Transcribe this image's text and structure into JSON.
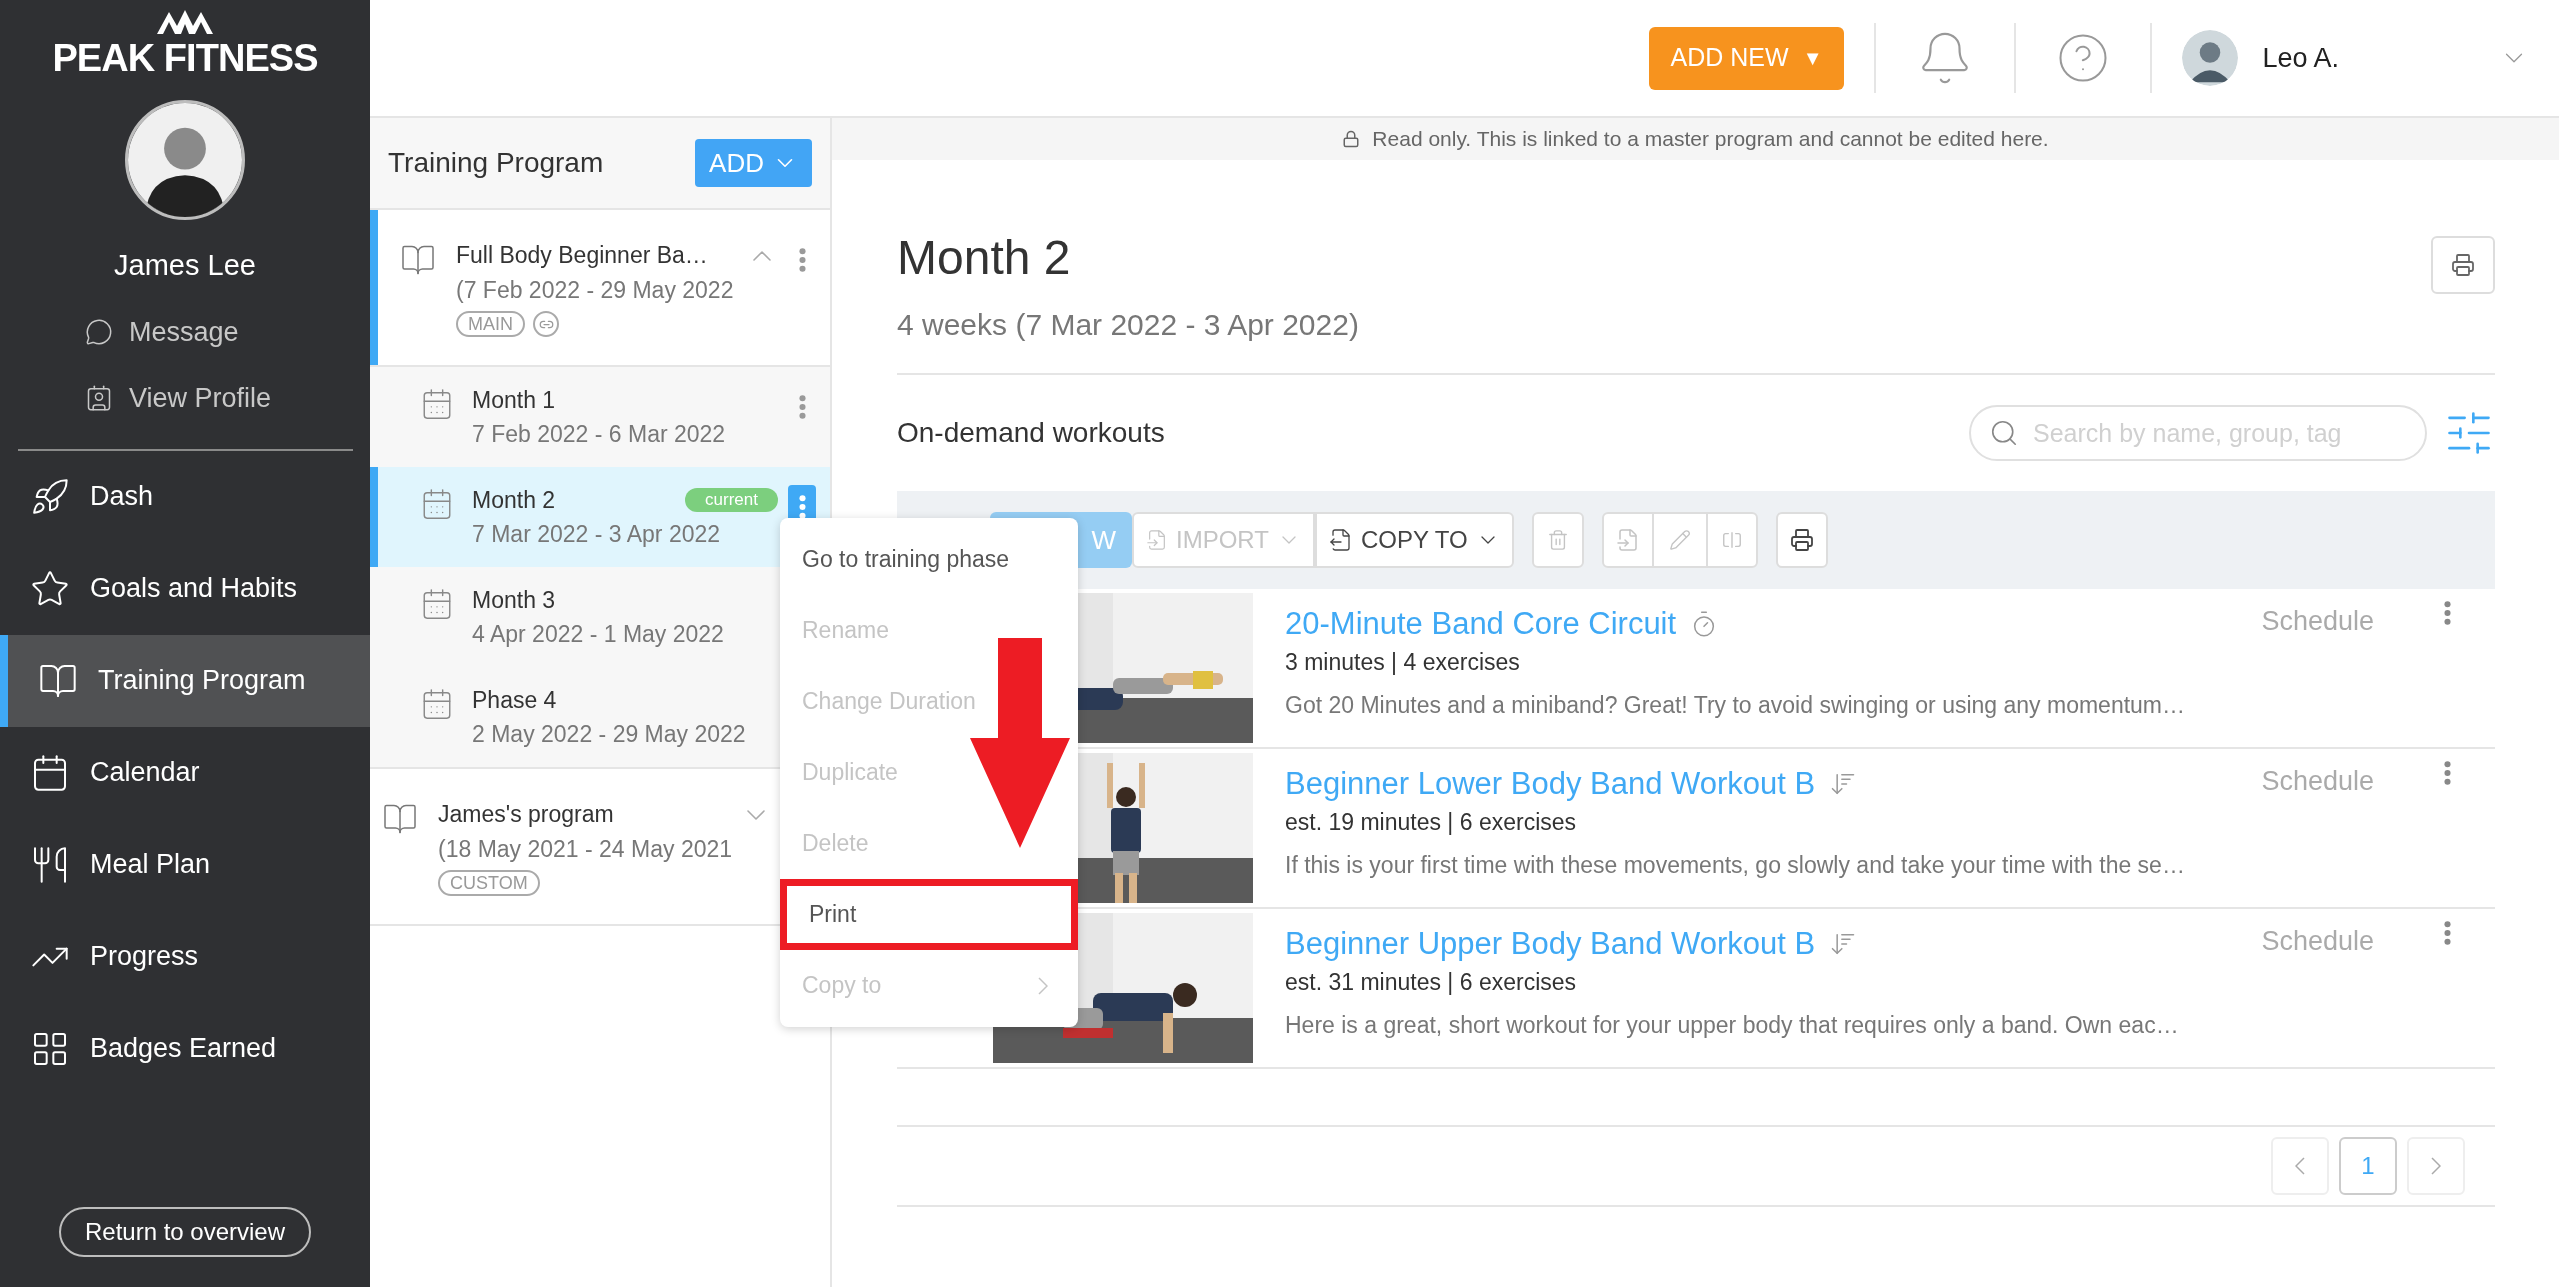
{
  "brand": {
    "name": "PEAK FITNESS"
  },
  "client": {
    "name": "James Lee",
    "links": [
      {
        "label": "Message"
      },
      {
        "label": "View Profile"
      }
    ]
  },
  "nav": [
    {
      "label": "Dash",
      "selected": false
    },
    {
      "label": "Goals and Habits",
      "selected": false
    },
    {
      "label": "Training Program",
      "selected": true
    },
    {
      "label": "Calendar",
      "selected": false
    },
    {
      "label": "Meal Plan",
      "selected": false
    },
    {
      "label": "Progress",
      "selected": false
    },
    {
      "label": "Badges Earned",
      "selected": false
    }
  ],
  "return_button": "Return to overview",
  "header": {
    "add_new": {
      "label": "ADD NEW",
      "caret": "▼"
    },
    "user": {
      "name": "Leo A."
    }
  },
  "banner": "Read only. This is linked to a master program and cannot be edited here.",
  "program_panel": {
    "title": "Training Program",
    "add_button": "ADD",
    "programs": [
      {
        "name": "Full Body Beginner Ba…",
        "dates": "(7 Feb 2022 - 29 May 2022",
        "tag": "MAIN",
        "linked": true,
        "expanded": true,
        "selected": true,
        "children": [
          {
            "name": "Month 1",
            "dates": "7 Feb 2022 - 6 Mar 2022",
            "selected": false,
            "menu_open": false
          },
          {
            "name": "Month 2",
            "dates": "7 Mar 2022 - 3 Apr 2022",
            "selected": true,
            "badge": "current",
            "menu_open": true
          },
          {
            "name": "Month 3",
            "dates": "4 Apr 2022 - 1 May 2022",
            "selected": false
          },
          {
            "name": "Phase 4",
            "dates": "2 May 2022 - 29 May 2022",
            "selected": false
          }
        ]
      },
      {
        "name": "James's program",
        "dates": "(18 May 2021 - 24 May 2021",
        "tag": "CUSTOM",
        "linked": false,
        "expanded": false,
        "selected": false
      }
    ]
  },
  "context_menu": {
    "arrow": true,
    "items": [
      {
        "label": "Go to training phase",
        "disabled": false,
        "highlighted": false
      },
      {
        "label": "Rename",
        "disabled": true,
        "highlighted": false
      },
      {
        "label": "Change Duration",
        "disabled": true,
        "highlighted": false
      },
      {
        "label": "Duplicate",
        "disabled": true,
        "highlighted": false
      },
      {
        "label": "Delete",
        "disabled": true,
        "highlighted": false
      },
      {
        "label": "Print",
        "disabled": false,
        "highlighted": true
      },
      {
        "label": "Copy to",
        "disabled": true,
        "highlighted": false,
        "submenu": true
      }
    ]
  },
  "phase": {
    "title": "Month 2",
    "subtitle": "4 weeks (7 Mar 2022 - 3 Apr 2022)"
  },
  "workouts": {
    "title": "On-demand workouts",
    "search": {
      "placeholder": "Search by name, group, tag"
    },
    "toolbar": [
      {
        "kind": "new",
        "label": "W",
        "disabled": true
      },
      {
        "kind": "import",
        "label": "IMPORT",
        "disabled": true
      },
      {
        "kind": "copy",
        "label": "COPY TO",
        "disabled": false
      },
      {
        "kind": "trash",
        "disabled": true
      },
      {
        "kind": "file",
        "disabled": true
      },
      {
        "kind": "edit",
        "disabled": true
      },
      {
        "kind": "split",
        "disabled": true
      },
      {
        "kind": "print",
        "disabled": false
      }
    ],
    "items": [
      {
        "title": "20-Minute Band Core Circuit",
        "kind": "timed",
        "meta": "3 minutes | 4 exercises",
        "description": "Got 20 Minutes and a miniband? Great! Try to avoid swinging or using any momentum…",
        "action": "Schedule"
      },
      {
        "title": "Beginner Lower Body Band Workout B",
        "kind": "sequence",
        "meta": "est. 19 minutes | 6 exercises",
        "description": "If this is your first time with these movements, go slowly and take your time with the se…",
        "action": "Schedule"
      },
      {
        "title": "Beginner Upper Body Band Workout B",
        "kind": "sequence",
        "meta": "est. 31 minutes | 6 exercises",
        "description": "Here is a great, short workout for your upper body that requires only a band. Own eac…",
        "action": "Schedule"
      }
    ]
  },
  "pagination": {
    "pages": [
      {
        "label": "1",
        "selected": true
      }
    ]
  }
}
